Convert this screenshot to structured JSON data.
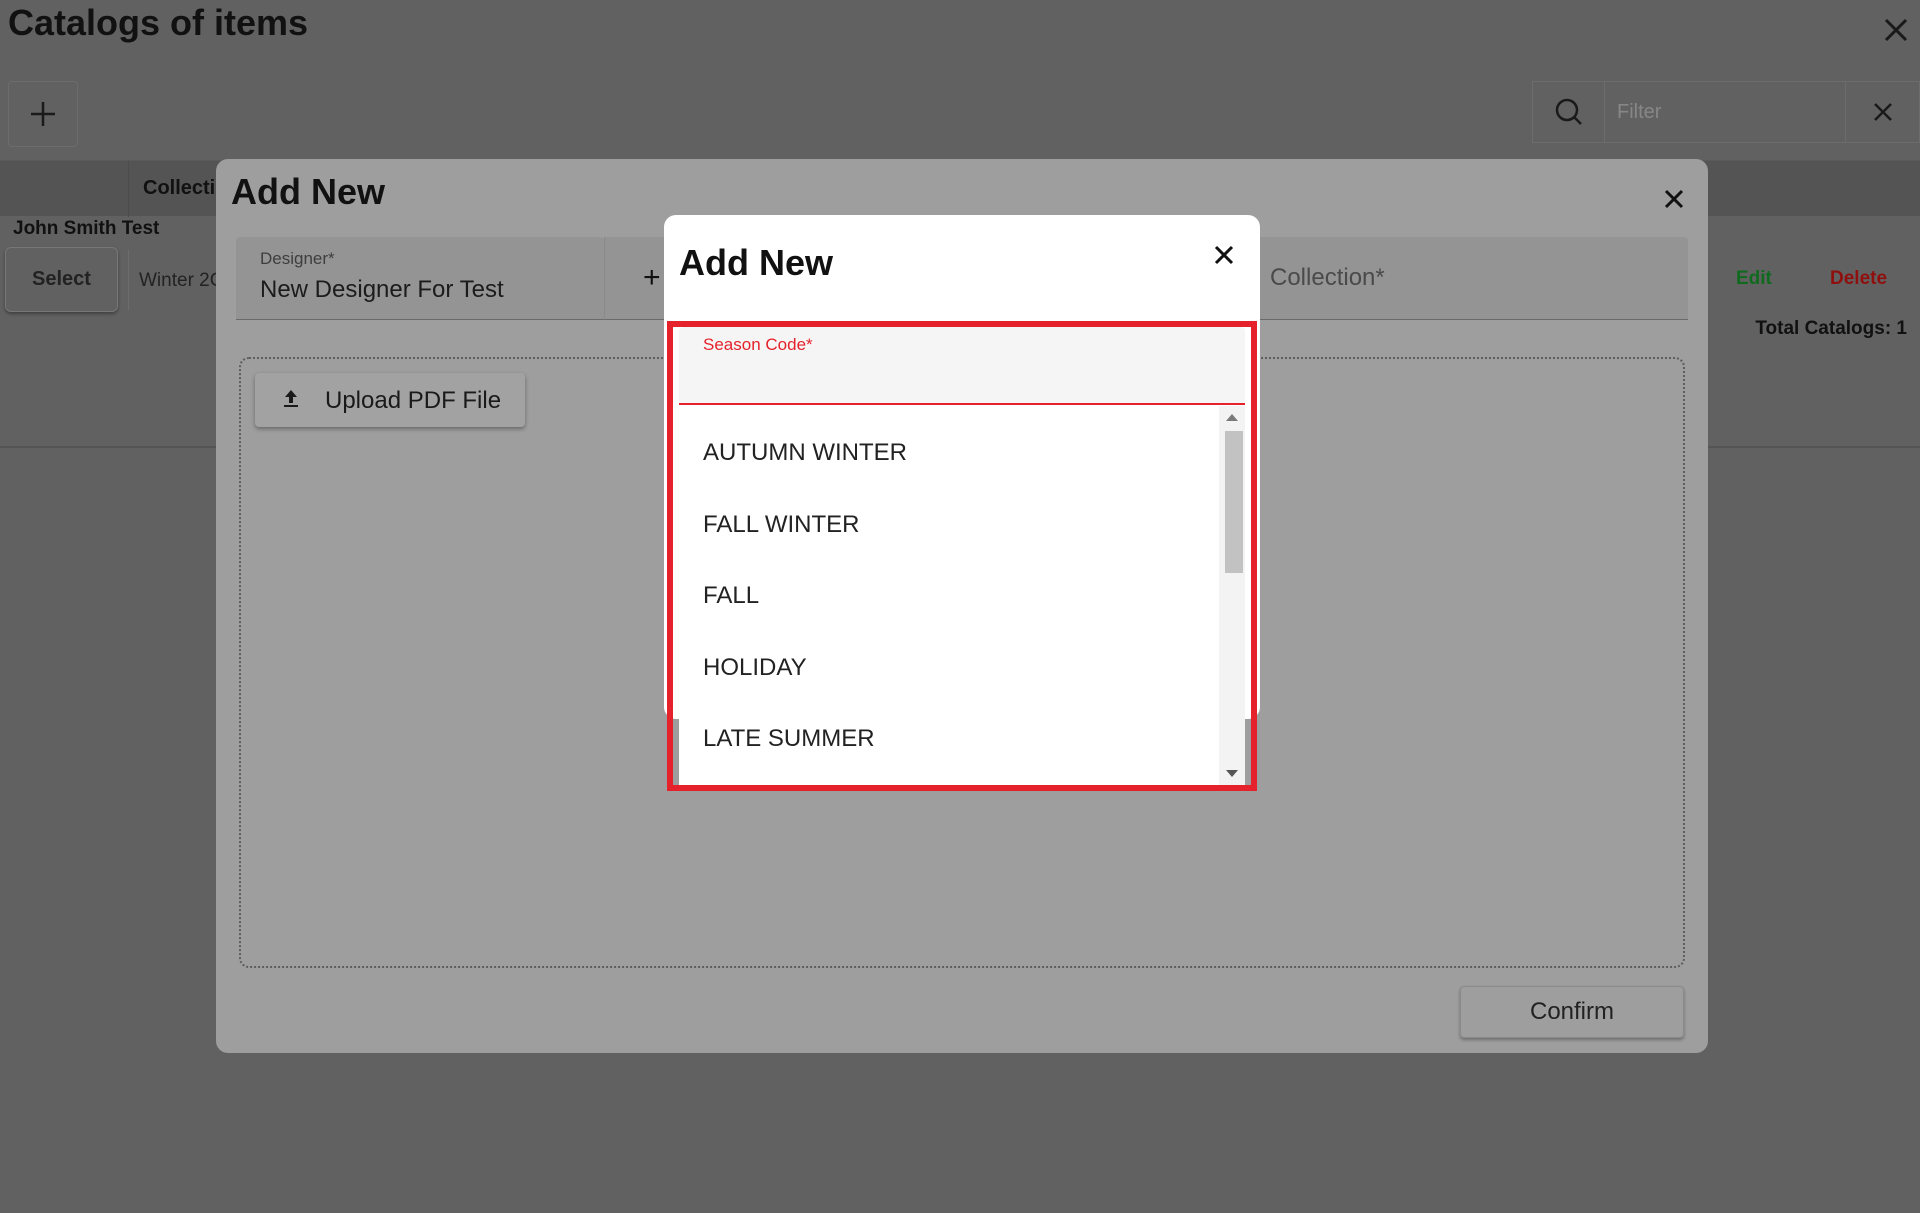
{
  "page": {
    "title": "Catalogs of items",
    "filter_placeholder": "Filter",
    "table": {
      "column_header": "Collectic",
      "group_label": "John Smith Test",
      "select_label": "Select",
      "cell_value": "Winter 2C",
      "edit_label": "Edit",
      "delete_label": "Delete",
      "total_label": "Total Catalogs: 1"
    }
  },
  "add_new_dialog": {
    "title": "Add New",
    "designer": {
      "label": "Designer*",
      "value": "New Designer For Test"
    },
    "collection_label": "Collection*",
    "upload_label": "Upload PDF File",
    "confirm_label": "Confirm"
  },
  "season_dialog": {
    "title": "Add New",
    "season_code": {
      "label": "Season Code*",
      "value": ""
    },
    "options": [
      "AUTUMN WINTER",
      "FALL WINTER",
      "FALL",
      "HOLIDAY",
      "LATE SUMMER"
    ]
  },
  "colors": {
    "highlight": "#e5222b",
    "edit": "#0f6a1e",
    "delete": "#8f0f0f"
  }
}
